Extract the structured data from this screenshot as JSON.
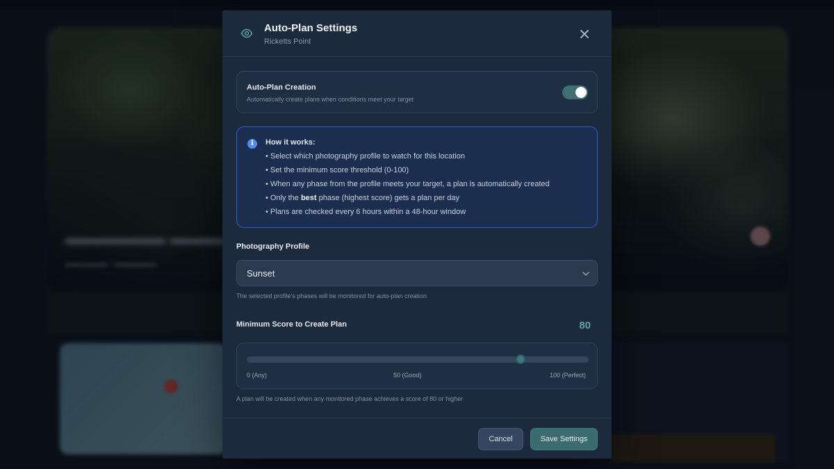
{
  "dialog": {
    "title": "Auto-Plan Settings",
    "subtitle": "Ricketts Point",
    "icon": "eye-icon",
    "close_icon": "close-icon"
  },
  "auto_plan": {
    "title": "Auto-Plan Creation",
    "description": "Automatically create plans when conditions meet your target",
    "enabled": true
  },
  "how_it_works": {
    "title": "How it works:",
    "items": [
      "• Select which photography profile to watch for this location",
      "• Set the minimum score threshold (0-100)",
      "• When any phase from the profile meets your target, a plan is automatically created",
      "• Plans are checked every 6 hours within a 48-hour window"
    ],
    "best_item": {
      "prefix": "• Only the ",
      "bold": "best",
      "suffix": " phase (highest score) gets a plan per day"
    }
  },
  "profile": {
    "label": "Photography Profile",
    "selected": "Sunset",
    "help": "The selected profile's phases will be monitored for auto-plan creation"
  },
  "min_score": {
    "label": "Minimum Score to Create Plan",
    "value": "80",
    "fraction": 0.8,
    "tick_min": "0 (Any)",
    "tick_mid": "50 (Good)",
    "tick_max": "100 (Perfect)",
    "help": "A plan will be created when any monitored phase achieves a score of 80 or higher"
  },
  "footer": {
    "cancel_label": "Cancel",
    "save_label": "Save Settings"
  },
  "colors": {
    "accent": "#3d6f75",
    "info_border": "#2f62c9",
    "score": "#5fa5a0"
  }
}
